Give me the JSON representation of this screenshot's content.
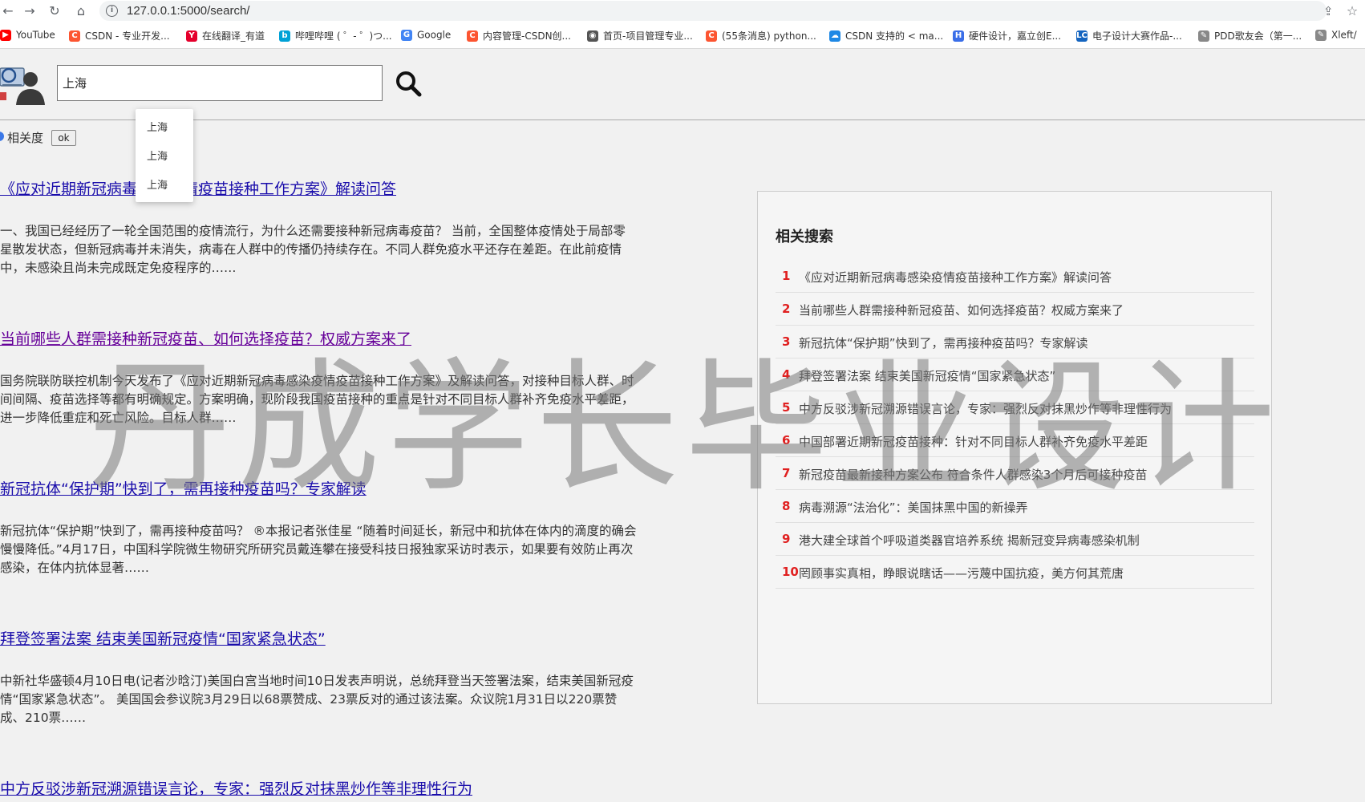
{
  "browser": {
    "url": "127.0.0.1:5000/search/",
    "bookmarks": [
      {
        "label": "YouTube",
        "icon": "youtube-icon",
        "color": "#ff0000"
      },
      {
        "label": "CSDN - 专业开发...",
        "icon": "csdn-icon",
        "color": "#fc5531"
      },
      {
        "label": "在线翻译_有道",
        "icon": "youdao-icon",
        "color": "#e5002c"
      },
      {
        "label": "哔哩哔哩 ( ゜- ゜)つ...",
        "icon": "bilibili-icon",
        "color": "#00a1d6"
      },
      {
        "label": "Google",
        "icon": "google-icon",
        "color": "#4285f4"
      },
      {
        "label": "内容管理-CSDN创...",
        "icon": "csdn-icon",
        "color": "#fc5531"
      },
      {
        "label": "首页-项目管理专业...",
        "icon": "globe-icon",
        "color": "#555555"
      },
      {
        "label": "(55条消息) python...",
        "icon": "csdn-icon",
        "color": "#fc5531"
      },
      {
        "label": "CSDN 支持的 < ma...",
        "icon": "cloud-icon",
        "color": "#1e88e5"
      },
      {
        "label": "硬件设计，嘉立创E...",
        "icon": "jlc-icon",
        "color": "#3a6ee8"
      },
      {
        "label": "电子设计大赛作品-...",
        "icon": "lc-icon",
        "color": "#1565c0"
      },
      {
        "label": "PDD歌友会（第一...",
        "icon": "pdd-icon",
        "color": "#888888"
      },
      {
        "label": "Xleft/",
        "icon": "xleft-icon",
        "color": "#888888"
      }
    ]
  },
  "search": {
    "value": "上海",
    "suggestions": [
      "上海",
      "上海",
      "上海"
    ]
  },
  "sort": {
    "label": "相关度",
    "ok_label": "ok"
  },
  "results": [
    {
      "title": "《应对近期新冠病毒感染疫情疫苗接种工作方案》解读问答",
      "snippet": "一、我国已经经历了一轮全国范围的疫情流行，为什么还需要接种新冠病毒疫苗？ 当前，全国整体疫情处于局部零星散发状态，但新冠病毒并未消失，病毒在人群中的传播仍持续存在。不同人群免疫水平还存在差距。在此前疫情中，未感染且尚未完成既定免疫程序的……",
      "visited": false
    },
    {
      "title": "当前哪些人群需接种新冠疫苗、如何选择疫苗？权威方案来了",
      "snippet": "国务院联防联控机制今天发布了《应对近期新冠病毒感染疫情疫苗接种工作方案》及解读问答，对接种目标人群、时间间隔、疫苗选择等都有明确规定。方案明确，现阶段我国疫苗接种的重点是针对不同目标人群补齐免疫水平差距，进一步降低重症和死亡风险。目标人群……",
      "visited": true
    },
    {
      "title": "新冠抗体“保护期”快到了，需再接种疫苗吗？专家解读",
      "snippet": "新冠抗体“保护期”快到了，需再接种疫苗吗？ ®本报记者张佳星 “随着时间延长，新冠中和抗体在体内的滴度的确会慢慢降低。”4月17日，中国科学院微生物研究所研究员戴连攀在接受科技日报独家采访时表示，如果要有效防止再次感染，在体内抗体显著……",
      "visited": false
    },
    {
      "title": "拜登签署法案 结束美国新冠疫情“国家紧急状态”",
      "snippet": "中新社华盛顿4月10日电(记者沙晗汀)美国白宫当地时间10日发表声明说，总统拜登当天签署法案，结束美国新冠疫情“国家紧急状态”。 美国国会参议院3月29日以68票赞成、23票反对的通过该法案。众议院1月31日以220票赞成、210票……",
      "visited": false
    },
    {
      "title": "中方反驳涉新冠溯源错误言论，专家：强烈反对抹黑炒作等非理性行为",
      "snippet": "",
      "visited": false
    }
  ],
  "related": {
    "title": "相关搜索",
    "items": [
      {
        "num": "1",
        "text": "《应对近期新冠病毒感染疫情疫苗接种工作方案》解读问答"
      },
      {
        "num": "2",
        "text": "当前哪些人群需接种新冠疫苗、如何选择疫苗？权威方案来了"
      },
      {
        "num": "3",
        "text": "新冠抗体“保护期”快到了，需再接种疫苗吗？专家解读"
      },
      {
        "num": "4",
        "text": "拜登签署法案 结束美国新冠疫情“国家紧急状态”"
      },
      {
        "num": "5",
        "text": "中方反驳涉新冠溯源错误言论，专家：强烈反对抹黑炒作等非理性行为"
      },
      {
        "num": "6",
        "text": "中国部署近期新冠疫苗接种：针对不同目标人群补齐免疫水平差距"
      },
      {
        "num": "7",
        "text": "新冠疫苗最新接种方案公布 符合条件人群感染3个月后可接种疫苗"
      },
      {
        "num": "8",
        "text": "病毒溯源“法治化”：美国抹黑中国的新操弄"
      },
      {
        "num": "9",
        "text": "港大建全球首个呼吸道类器官培养系统 揭新冠变异病毒感染机制"
      },
      {
        "num": "10",
        "text": "罔顾事实真相，睁眼说瞎话——污蔑中国抗疫，美方何其荒唐"
      }
    ]
  },
  "watermark": "丹成学长毕业设计"
}
